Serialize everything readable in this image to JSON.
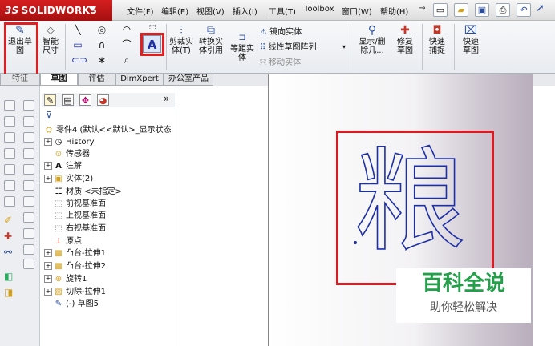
{
  "app": {
    "logo_text": "SOLIDWORKS"
  },
  "menu": [
    "文件(F)",
    "编辑(E)",
    "视图(V)",
    "插入(I)",
    "工具(T)",
    "Toolbox",
    "窗口(W)",
    "帮助(H)"
  ],
  "commands": {
    "exit_sketch": "退出草图",
    "smart_dimension": "智能尺寸",
    "trim": "剪裁实体(T)",
    "convert": "转换实体引用",
    "offset": "等距实体",
    "mirror": "镜向实体",
    "linear_pattern": "线性草图阵列",
    "move": "移动实体",
    "display_delete": "显示/删除几...",
    "repair": "修复草图",
    "quick_snap": "快速捕捉",
    "rapid_sketch": "快速草图"
  },
  "tabs": [
    "特征",
    "草图",
    "评估",
    "DimXpert",
    "办公室产品"
  ],
  "tree": {
    "root": "零件4 (默认<<默认>_显示状态",
    "items": [
      {
        "label": "History",
        "expandable": true,
        "icon": "history-icon"
      },
      {
        "label": "传感器",
        "expandable": false,
        "icon": "sensor-icon"
      },
      {
        "label": "注解",
        "expandable": true,
        "icon": "annotation-icon"
      },
      {
        "label": "实体(2)",
        "expandable": true,
        "icon": "solid-bodies-icon"
      },
      {
        "label": "材质 <未指定>",
        "expandable": false,
        "icon": "material-icon"
      },
      {
        "label": "前视基准面",
        "expandable": false,
        "icon": "plane-icon"
      },
      {
        "label": "上视基准面",
        "expandable": false,
        "icon": "plane-icon"
      },
      {
        "label": "右视基准面",
        "expandable": false,
        "icon": "plane-icon"
      },
      {
        "label": "原点",
        "expandable": false,
        "icon": "origin-icon"
      },
      {
        "label": "凸台-拉伸1",
        "expandable": true,
        "icon": "boss-extrude-icon"
      },
      {
        "label": "凸台-拉伸2",
        "expandable": true,
        "icon": "boss-extrude-icon"
      },
      {
        "label": "旋转1",
        "expandable": true,
        "icon": "revolve-icon"
      },
      {
        "label": "切除-拉伸1",
        "expandable": true,
        "icon": "cut-extrude-icon"
      },
      {
        "label": "(-) 草图5",
        "expandable": false,
        "icon": "sketch-icon"
      }
    ]
  },
  "canvas": {
    "sketch_text": "粮"
  },
  "watermark": {
    "title": "百科全说",
    "subtitle": "助你轻松解决"
  },
  "colors": {
    "accent_red": "#d81c24",
    "sketch_blue": "#1d2fa8",
    "watermark_green": "#25a04a"
  }
}
